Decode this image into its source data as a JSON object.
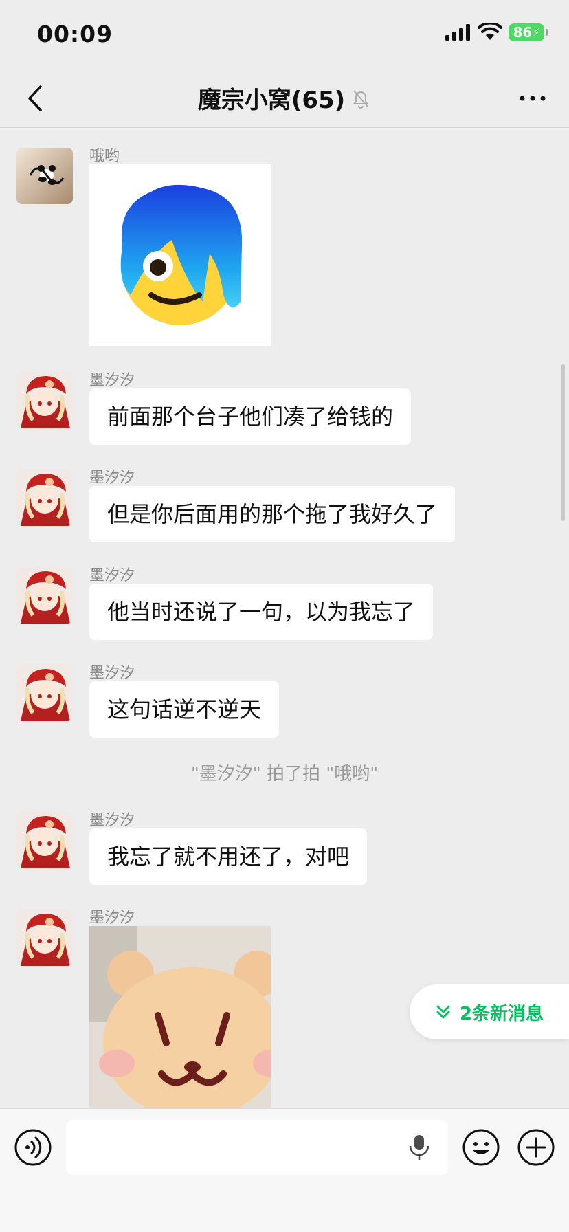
{
  "status_bar": {
    "time": "00:09",
    "battery": "86"
  },
  "nav": {
    "title": "魔宗小窝(65)"
  },
  "messages": [
    {
      "sender": "哦哟",
      "type": "sticker",
      "sticker": "blue-hair-emoji-sticker"
    },
    {
      "sender": "墨汐汐",
      "type": "text",
      "text": "前面那个台子他们凑了给钱的"
    },
    {
      "sender": "墨汐汐",
      "type": "text",
      "text": "但是你后面用的那个拖了我好久了"
    },
    {
      "sender": "墨汐汐",
      "type": "text",
      "text": "他当时还说了一句，以为我忘了"
    },
    {
      "sender": "墨汐汐",
      "type": "text",
      "text": "这句话逆不逆天"
    },
    {
      "type": "system",
      "text": "\"墨汐汐\" 拍了拍 \"哦哟\""
    },
    {
      "sender": "墨汐汐",
      "type": "text",
      "text": "我忘了就不用还了，对吧"
    },
    {
      "sender": "墨汐汐",
      "type": "sticker",
      "sticker": "bear-plush-sticker"
    }
  ],
  "new_messages_button": {
    "label": "2条新消息"
  },
  "input": {
    "placeholder": ""
  },
  "colors": {
    "accent": "#07c160",
    "bubble": "#ffffff",
    "background": "#ededed"
  }
}
